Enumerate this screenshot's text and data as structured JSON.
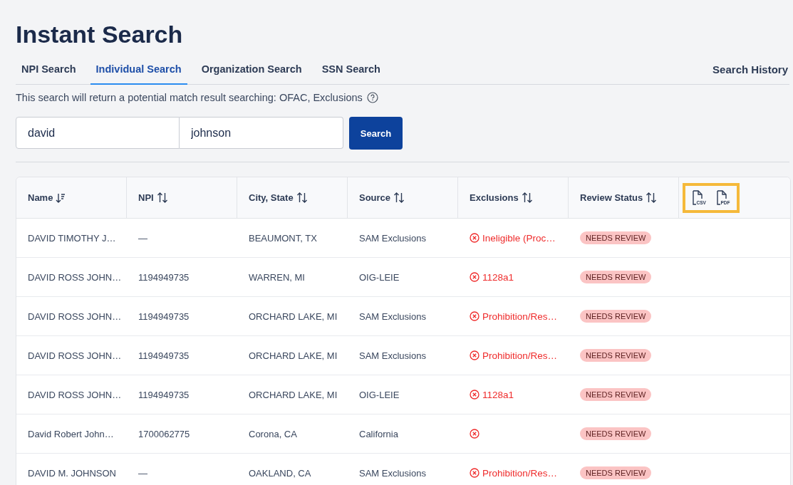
{
  "title": "Instant Search",
  "tabs": [
    {
      "label": "NPI Search",
      "selected": false
    },
    {
      "label": "Individual Search",
      "selected": true
    },
    {
      "label": "Organization Search",
      "selected": false
    },
    {
      "label": "SSN Search",
      "selected": false
    }
  ],
  "search_history": "Search History",
  "description": "This search will return a potential match result searching: OFAC, Exclusions",
  "fields": [
    {
      "value": "david"
    },
    {
      "value": "johnson"
    }
  ],
  "search_button": "Search",
  "table": {
    "columns": [
      {
        "label": "Name",
        "kind": "sorted"
      },
      {
        "label": "NPI",
        "kind": "sortable"
      },
      {
        "label": "City, State",
        "kind": "sortable"
      },
      {
        "label": "Source",
        "kind": "sortable"
      },
      {
        "label": "Exclusions",
        "kind": "sortable"
      },
      {
        "label": "Review Status",
        "kind": "sortable"
      }
    ],
    "export_buttons": [
      {
        "label": "CSV"
      },
      {
        "label": "PDF"
      }
    ],
    "rows": [
      {
        "name": "DAVID TIMOTHY J…",
        "npi": "—",
        "city_state": "BEAUMONT, TX",
        "source": "SAM Exclusions",
        "exclusion": "Ineligible (Proc…",
        "status": "NEEDS REVIEW"
      },
      {
        "name": "DAVID ROSS JOHN…",
        "npi": "1194949735",
        "city_state": "WARREN, MI",
        "source": "OIG-LEIE",
        "exclusion": "1128a1",
        "status": "NEEDS REVIEW"
      },
      {
        "name": "DAVID ROSS JOHN…",
        "npi": "1194949735",
        "city_state": "ORCHARD LAKE, MI",
        "source": "SAM Exclusions",
        "exclusion": "Prohibition/Res…",
        "status": "NEEDS REVIEW"
      },
      {
        "name": "DAVID ROSS JOHN…",
        "npi": "1194949735",
        "city_state": "ORCHARD LAKE, MI",
        "source": "SAM Exclusions",
        "exclusion": "Prohibition/Res…",
        "status": "NEEDS REVIEW"
      },
      {
        "name": "DAVID ROSS JOHN…",
        "npi": "1194949735",
        "city_state": "ORCHARD LAKE, MI",
        "source": "OIG-LEIE",
        "exclusion": "1128a1",
        "status": "NEEDS REVIEW"
      },
      {
        "name": "David Robert John…",
        "npi": "1700062775",
        "city_state": "Corona, CA",
        "source": "California",
        "status": "NEEDS REVIEW"
      },
      {
        "name": "DAVID M. JOHNSON",
        "npi": "—",
        "city_state": "OAKLAND, CA",
        "source": "SAM Exclusions",
        "exclusion": "Prohibition/Res…",
        "status": "NEEDS REVIEW"
      }
    ]
  }
}
